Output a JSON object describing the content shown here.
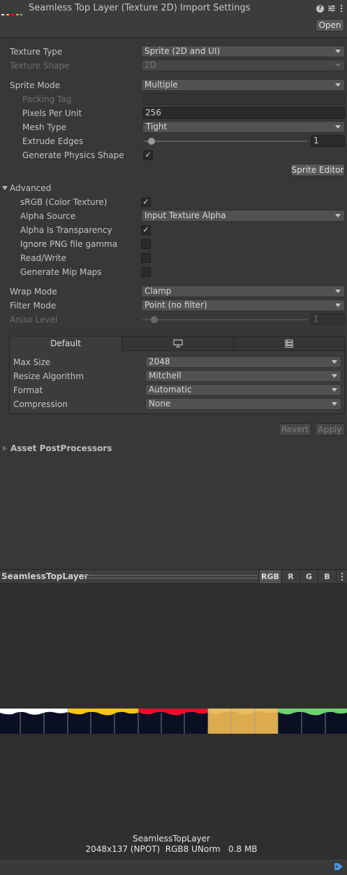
{
  "header": {
    "title": "Seamless Top Layer (Texture 2D) Import Settings",
    "open_label": "Open",
    "icons": [
      "texture-thumbnail-icon",
      "help-icon",
      "preset-icon",
      "kebab-menu-icon"
    ]
  },
  "texture_type": {
    "label": "Texture Type",
    "value": "Sprite (2D and UI)"
  },
  "texture_shape": {
    "label": "Texture Shape",
    "value": "2D"
  },
  "sprite_mode": {
    "label": "Sprite Mode",
    "value": "Multiple"
  },
  "packing_tag": {
    "label": "Packing Tag",
    "value": ""
  },
  "pixels_per_unit": {
    "label": "Pixels Per Unit",
    "value": "256"
  },
  "mesh_type": {
    "label": "Mesh Type",
    "value": "Tight"
  },
  "extrude_edges": {
    "label": "Extrude Edges",
    "value": "1",
    "slider_fraction": 0.0
  },
  "generate_physics_shape": {
    "label": "Generate Physics Shape",
    "checked": true
  },
  "sprite_editor_label": "Sprite Editor",
  "advanced": {
    "label": "Advanced",
    "srgb": {
      "label": "sRGB (Color Texture)",
      "checked": true
    },
    "alpha_source": {
      "label": "Alpha Source",
      "value": "Input Texture Alpha"
    },
    "alpha_is_transparency": {
      "label": "Alpha Is Transparency",
      "checked": true
    },
    "ignore_png_gamma": {
      "label": "Ignore PNG file gamma",
      "checked": false
    },
    "read_write": {
      "label": "Read/Write",
      "checked": false
    },
    "generate_mip_maps": {
      "label": "Generate Mip Maps",
      "checked": false
    }
  },
  "wrap_mode": {
    "label": "Wrap Mode",
    "value": "Clamp"
  },
  "filter_mode": {
    "label": "Filter Mode",
    "value": "Point (no filter)"
  },
  "aniso_level": {
    "label": "Aniso Level",
    "value": "1",
    "slider_fraction": 0.0
  },
  "platform": {
    "tabs": [
      {
        "label": "Default",
        "icon": ""
      },
      {
        "label": "",
        "icon": "monitor-icon"
      },
      {
        "label": "",
        "icon": "server-icon"
      }
    ],
    "max_size": {
      "label": "Max Size",
      "value": "2048"
    },
    "resize_algorithm": {
      "label": "Resize Algorithm",
      "value": "Mitchell"
    },
    "format": {
      "label": "Format",
      "value": "Automatic"
    },
    "compression": {
      "label": "Compression",
      "value": "None"
    }
  },
  "revert_label": "Revert",
  "apply_label": "Apply",
  "asset_postprocessors_label": "Asset PostProcessors",
  "preview": {
    "name": "SeamlessTopLayer",
    "channels": [
      "RGB",
      "R",
      "G",
      "B"
    ],
    "info_name": "SeamlessTopLayer",
    "info_details": "2048x137 (NPOT)  RGB8 UNorm   0.8 MB",
    "strip_colors": [
      "#ffffff",
      "#f5c518",
      "#e8112d",
      "#dbab4e",
      "#6fd16f"
    ]
  },
  "footer_icon": "asset-label-icon"
}
